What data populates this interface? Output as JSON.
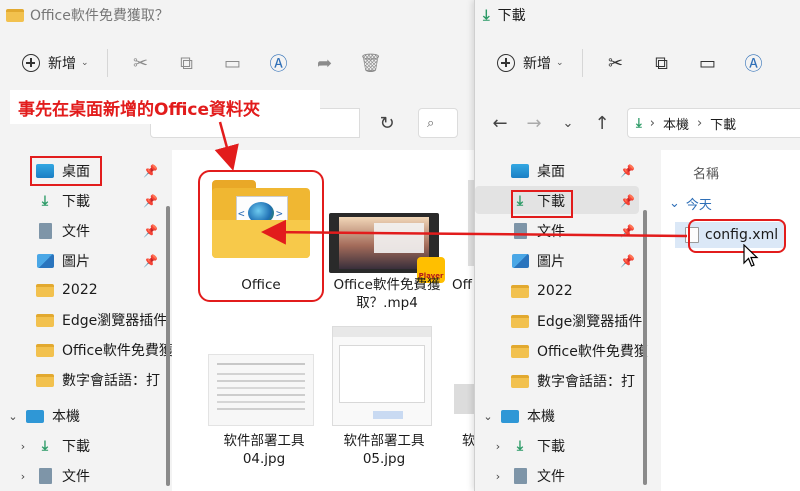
{
  "left_window": {
    "title": "Office軟件免費獲取？",
    "toolbar": {
      "new_label": "新增"
    },
    "sidebar": {
      "quick": [
        {
          "label": "桌面",
          "icon": "desktop-icon",
          "pinned": true
        },
        {
          "label": "下載",
          "icon": "download-icon",
          "pinned": true
        },
        {
          "label": "文件",
          "icon": "document-icon",
          "pinned": true
        },
        {
          "label": "圖片",
          "icon": "pictures-icon",
          "pinned": true
        },
        {
          "label": "2022",
          "icon": "folder-icon",
          "pinned": false
        },
        {
          "label": "Edge瀏覽器插件",
          "icon": "folder-icon",
          "pinned": false
        },
        {
          "label": "Office軟件免費獲",
          "icon": "folder-icon",
          "pinned": false
        },
        {
          "label": "數字會話語：打",
          "icon": "folder-icon",
          "pinned": false
        }
      ],
      "this_pc": {
        "label": "本機"
      },
      "pc_items": [
        {
          "label": "下載"
        },
        {
          "label": "文件"
        }
      ]
    },
    "files": [
      {
        "label": "Office"
      },
      {
        "label": "Office軟件免費獲\n取？.mp4",
        "badge": "Player"
      },
      {
        "label": "Off"
      },
      {
        "label": "软件部署工具\n04.jpg"
      },
      {
        "label": "软件部署工具\n05.jpg"
      },
      {
        "label": "软"
      }
    ]
  },
  "right_window": {
    "title": "下載",
    "toolbar": {
      "new_label": "新增"
    },
    "breadcrumb": [
      "本機",
      "下載"
    ],
    "column_header": "名稱",
    "group_header": "今天",
    "file": {
      "label": "config.xml"
    },
    "sidebar": {
      "quick": [
        {
          "label": "桌面"
        },
        {
          "label": "下載"
        },
        {
          "label": "文件"
        },
        {
          "label": "圖片"
        },
        {
          "label": "2022"
        },
        {
          "label": "Edge瀏覽器插件"
        },
        {
          "label": "Office軟件免費獲"
        },
        {
          "label": "數字會話語：打"
        }
      ],
      "this_pc": {
        "label": "本機"
      },
      "pc_items": [
        {
          "label": "下載"
        },
        {
          "label": "文件"
        }
      ]
    }
  },
  "annotation": {
    "text": "事先在桌面新增的Office資料夾"
  },
  "colors": {
    "annotation_red": "#e21c1c",
    "accent_blue": "#2f6fb7",
    "folder_yellow": "#f2c14e",
    "download_green": "#2b9a66"
  }
}
